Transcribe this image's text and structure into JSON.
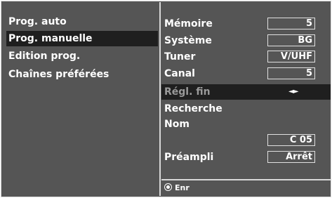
{
  "menu": {
    "items": [
      {
        "label": "Prog. auto",
        "selected": false
      },
      {
        "label": "Prog. manuelle",
        "selected": true
      },
      {
        "label": "Edition prog.",
        "selected": false
      },
      {
        "label": "Chaînes préférées",
        "selected": false
      }
    ]
  },
  "settings": {
    "memoire": {
      "label": "Mémoire",
      "value": "5"
    },
    "systeme": {
      "label": "Système",
      "value": "BG"
    },
    "tuner": {
      "label": "Tuner",
      "value": "V/UHF"
    },
    "canal": {
      "label": "Canal",
      "value": "5"
    },
    "regl_fin": {
      "label": "Régl. fin",
      "value": "◄►"
    },
    "recherche": {
      "label": "Recherche"
    },
    "nom": {
      "label": "Nom",
      "value": "C 05"
    },
    "preampli": {
      "label": "Préampli",
      "value": "Arrêt"
    }
  },
  "footer": {
    "icon": "ok-button-icon",
    "label": "Enr"
  },
  "colors": {
    "panel": "#555555",
    "highlight": "#1f1f1f",
    "border": "#d8d8d8",
    "text": "#ffffff"
  }
}
